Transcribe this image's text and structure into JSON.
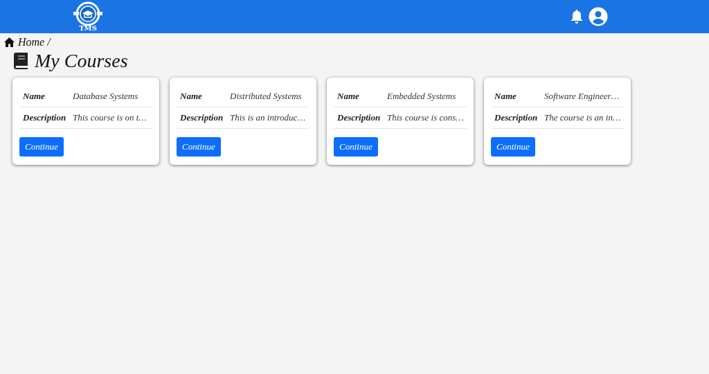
{
  "header": {
    "logo_text": "TMS"
  },
  "breadcrumb": {
    "items": [
      "Home /"
    ]
  },
  "page_title": "My Courses",
  "courses": [
    {
      "name_label": "Name",
      "name": "Database Systems",
      "description_label": "Description",
      "description": "This course is on t…",
      "button": "Continue"
    },
    {
      "name_label": "Name",
      "name": "Distributed Systems",
      "description_label": "Description",
      "description": "This is an introduc…",
      "button": "Continue"
    },
    {
      "name_label": "Name",
      "name": "Embedded Systems",
      "description_label": "Description",
      "description": "This course is cons…",
      "button": "Continue"
    },
    {
      "name_label": "Name",
      "name": "Software Engineer…",
      "description_label": "Description",
      "description": "The course is an in…",
      "button": "Continue"
    }
  ]
}
